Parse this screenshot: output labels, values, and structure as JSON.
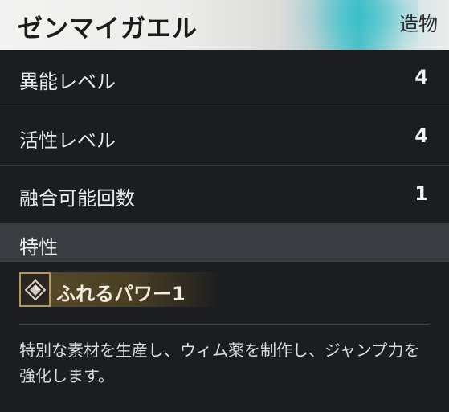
{
  "header": {
    "title": "ゼンマイガエル",
    "category": "造物"
  },
  "stats": [
    {
      "label": "異能レベル",
      "value": "4"
    },
    {
      "label": "活性レベル",
      "value": "4"
    },
    {
      "label": "融合可能回数",
      "value": "1"
    }
  ],
  "traits_section": {
    "label": "特性",
    "items": [
      {
        "label": "ふれるパワー1",
        "icon": "diamond-icon"
      }
    ]
  },
  "description": "特別な素材を生産し、ウィム薬を制作し、ジャンプ力を強化します。",
  "colors": {
    "header_accent": "#4fc0c8",
    "trait_gold": "#b39a57",
    "panel_bg": "#1b1d20",
    "section_bg": "#393c40"
  }
}
